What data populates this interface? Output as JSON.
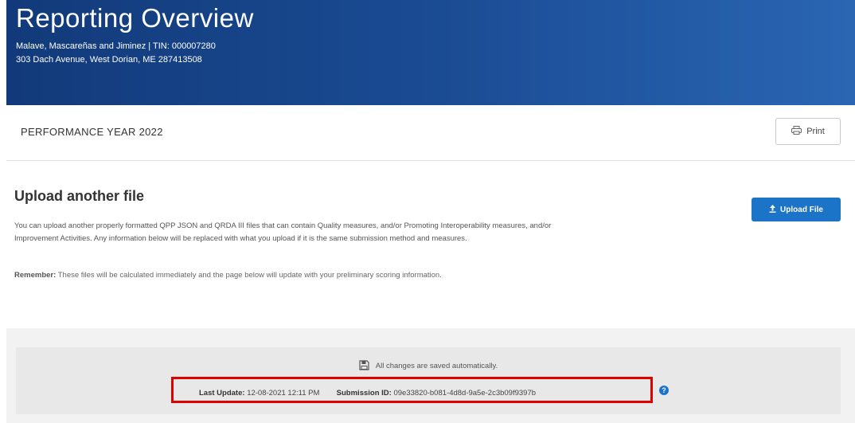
{
  "header": {
    "title": "Reporting Overview",
    "practice_line": "Malave, Mascareñas and Jiminez | TIN: 000007280",
    "address_line": "303 Dach Avenue, West Dorian, ME 287413508"
  },
  "performance": {
    "year_label": "PERFORMANCE YEAR 2022",
    "print_label": "Print"
  },
  "upload": {
    "title": "Upload another file",
    "button_label": "Upload File",
    "description": "You can upload another properly formatted QPP JSON and QRDA III files that can contain Quality measures, and/or Promoting Interoperability measures, and/or Improvement Activities. Any information below will be replaced with what you upload if it is the same submission method and measures.",
    "remember_label": "Remember:",
    "remember_text": " These files will be calculated immediately and the page below will update with your preliminary scoring information."
  },
  "footer": {
    "saved_text": "All changes are saved automatically.",
    "last_update_label": "Last Update:",
    "last_update_value": "12-08-2021 12:11 PM",
    "submission_label": "Submission ID:",
    "submission_value": "09e33820-b081-4d8d-9a5e-2c3b09f9397b"
  },
  "colors": {
    "header_start": "#123a7a",
    "header_end": "#2a66b3",
    "primary_button": "#1b74c8",
    "highlight": "#e00000"
  },
  "icons": {
    "print": "printer-icon",
    "upload": "upload-arrow-icon",
    "save": "save-disk-icon",
    "info": "info-icon"
  }
}
